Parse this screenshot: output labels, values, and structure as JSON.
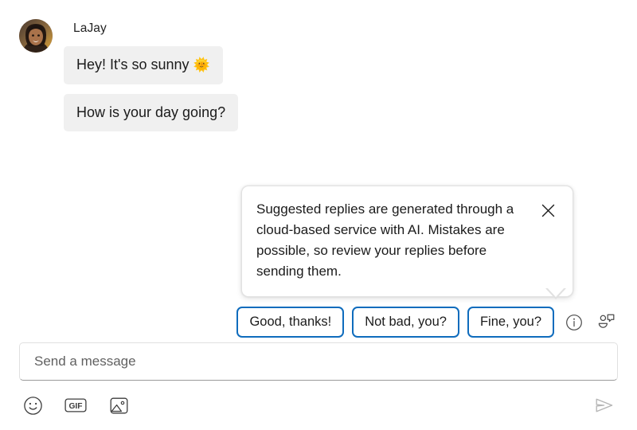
{
  "conversation": {
    "sender_name": "LaJay",
    "avatar_alt": "contact-photo",
    "messages": [
      {
        "text": "Hey! It's so sunny ",
        "emoji": "🌞"
      },
      {
        "text": "How is your day going?",
        "emoji": ""
      }
    ]
  },
  "callout": {
    "text": "Suggested replies are generated through a cloud-based service with AI. Mistakes are possible, so review your replies before sending them.",
    "close_label": "✕",
    "close_icon": "close-icon"
  },
  "suggestions": {
    "chips": [
      {
        "label": "Good, thanks!"
      },
      {
        "label": "Not bad, you?"
      },
      {
        "label": "Fine, you?"
      }
    ],
    "info_icon": "info-circle-icon",
    "settings_icon": "suggested-replies-icon",
    "accent_color": "#0f6cbd"
  },
  "composer": {
    "placeholder": "Send a message",
    "value": "",
    "tools": [
      {
        "name": "emoji-icon",
        "label": "Emoji"
      },
      {
        "name": "gif-icon",
        "label": "GIF"
      },
      {
        "name": "image-icon",
        "label": "Image"
      }
    ],
    "send_icon": "send-icon",
    "send_label": "Send"
  },
  "colors": {
    "bubble_background": "#f0f0f0",
    "text": "#1b1b1b",
    "accent": "#0f6cbd",
    "send_disabled": "#b5b5b5"
  }
}
